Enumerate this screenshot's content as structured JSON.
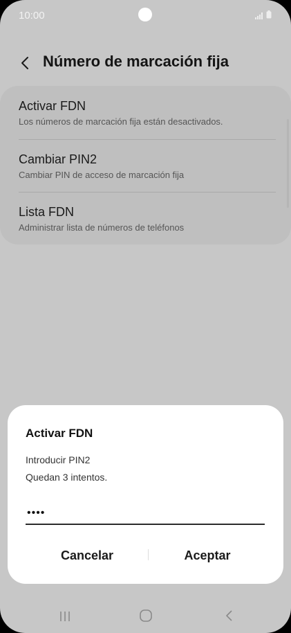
{
  "status_bar": {
    "time": "10:00"
  },
  "header": {
    "title": "Número de marcación fija"
  },
  "settings": {
    "items": [
      {
        "title": "Activar FDN",
        "subtitle": "Los números de marcación fija están desactivados."
      },
      {
        "title": "Cambiar PIN2",
        "subtitle": "Cambiar PIN de acceso de marcación fija"
      },
      {
        "title": "Lista FDN",
        "subtitle": "Administrar lista de números de teléfonos"
      }
    ]
  },
  "dialog": {
    "title": "Activar FDN",
    "prompt": "Introducir PIN2",
    "attempts": "Quedan 3 intentos.",
    "pin_value": "••••",
    "cancel_label": "Cancelar",
    "accept_label": "Aceptar"
  }
}
